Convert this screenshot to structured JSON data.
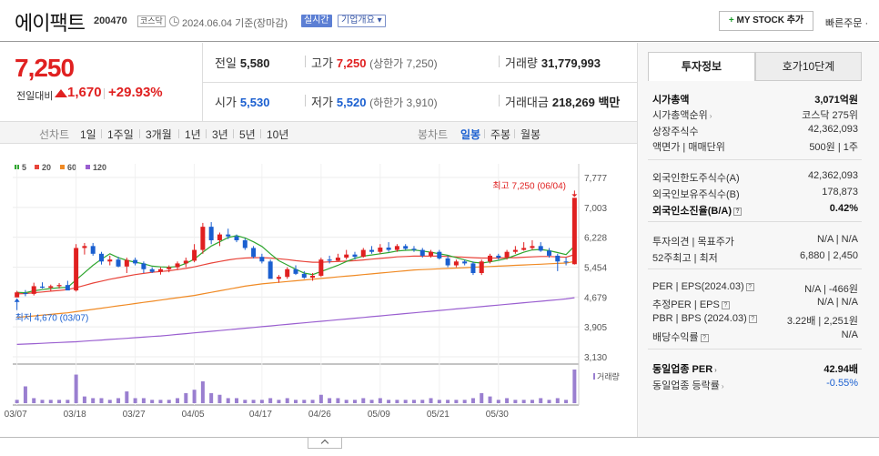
{
  "header": {
    "stock_name": "에이팩트",
    "stock_code": "200470",
    "market": "코스닥",
    "date": "2024.06.04 기준(장마감)",
    "realtime": "실시간",
    "company_info": "기업개요 ▾",
    "my_stock": "MY STOCK 추가",
    "quick_order": "빠른주문 ·"
  },
  "price": {
    "current": "7,250",
    "change_label": "전일대비",
    "change": "1,670",
    "change_rate": "+29.93%"
  },
  "stats": {
    "prev_close_label": "전일",
    "prev_close": "5,580",
    "high_label": "고가",
    "high": "7,250",
    "upper_limit": "(상한가 7,250)",
    "volume_label": "거래량",
    "volume": "31,779,993",
    "open_label": "시가",
    "open": "5,530",
    "low_label": "저가",
    "low": "5,520",
    "lower_limit": "(하한가 3,910)",
    "amount_label": "거래대금",
    "amount": "218,269",
    "amount_unit": "백만"
  },
  "period_bar": {
    "line_chart": "선차트",
    "periods": [
      "1일",
      "1주일",
      "3개월",
      "1년",
      "3년",
      "5년",
      "10년"
    ],
    "candle_chart": "봉차트",
    "candle_periods": [
      "일봉",
      "주봉",
      "월봉"
    ],
    "active_candle": "일봉"
  },
  "chart_data": {
    "type": "candlestick",
    "legend": [
      {
        "name": "5",
        "color": "#2fa62f"
      },
      {
        "name": "20",
        "color": "#e8443a"
      },
      {
        "name": "60",
        "color": "#f08a24"
      },
      {
        "name": "120",
        "color": "#9a5fd0"
      }
    ],
    "y_ticks": [
      "7,777",
      "7,003",
      "6,228",
      "5,454",
      "4,679",
      "3,905",
      "3,130"
    ],
    "ylim": [
      3130,
      7777
    ],
    "x_ticks": [
      "03/07",
      "03/18",
      "03/27",
      "04/05",
      "04/17",
      "04/26",
      "05/09",
      "05/21",
      "05/30"
    ],
    "high_annotation": "최고 7,250 (06/04)",
    "low_annotation": "최저 4,670 (03/07)",
    "volume_label": "거래량",
    "candles": [
      {
        "o": 4670,
        "h": 4840,
        "l": 4670,
        "c": 4800,
        "v": 2
      },
      {
        "o": 4780,
        "h": 4860,
        "l": 4700,
        "c": 4760,
        "v": 10
      },
      {
        "o": 4760,
        "h": 5050,
        "l": 4720,
        "c": 4960,
        "v": 3
      },
      {
        "o": 4950,
        "h": 5060,
        "l": 4900,
        "c": 4920,
        "v": 2
      },
      {
        "o": 4920,
        "h": 5000,
        "l": 4830,
        "c": 4960,
        "v": 2
      },
      {
        "o": 4960,
        "h": 5040,
        "l": 4900,
        "c": 4990,
        "v": 2
      },
      {
        "o": 4990,
        "h": 5100,
        "l": 4860,
        "c": 4850,
        "v": 2
      },
      {
        "o": 4850,
        "h": 6050,
        "l": 4820,
        "c": 5950,
        "v": 17
      },
      {
        "o": 5950,
        "h": 6080,
        "l": 5780,
        "c": 6000,
        "v": 4
      },
      {
        "o": 6000,
        "h": 6080,
        "l": 5750,
        "c": 5800,
        "v": 3
      },
      {
        "o": 5800,
        "h": 5850,
        "l": 5520,
        "c": 5600,
        "v": 3
      },
      {
        "o": 5600,
        "h": 5750,
        "l": 5500,
        "c": 5650,
        "v": 2
      },
      {
        "o": 5650,
        "h": 5720,
        "l": 5450,
        "c": 5470,
        "v": 3
      },
      {
        "o": 5470,
        "h": 5700,
        "l": 5300,
        "c": 5640,
        "v": 7
      },
      {
        "o": 5640,
        "h": 5700,
        "l": 5500,
        "c": 5550,
        "v": 3
      },
      {
        "o": 5550,
        "h": 5600,
        "l": 5300,
        "c": 5400,
        "v": 3
      },
      {
        "o": 5400,
        "h": 5450,
        "l": 5300,
        "c": 5330,
        "v": 2
      },
      {
        "o": 5330,
        "h": 5450,
        "l": 5260,
        "c": 5400,
        "v": 2
      },
      {
        "o": 5400,
        "h": 5500,
        "l": 5320,
        "c": 5450,
        "v": 2
      },
      {
        "o": 5450,
        "h": 5600,
        "l": 5380,
        "c": 5550,
        "v": 3
      },
      {
        "o": 5550,
        "h": 5700,
        "l": 5450,
        "c": 5620,
        "v": 6
      },
      {
        "o": 5620,
        "h": 6050,
        "l": 5580,
        "c": 5900,
        "v": 8
      },
      {
        "o": 5900,
        "h": 6600,
        "l": 5800,
        "c": 6500,
        "v": 13
      },
      {
        "o": 6500,
        "h": 6620,
        "l": 6050,
        "c": 6150,
        "v": 6
      },
      {
        "o": 6150,
        "h": 6350,
        "l": 6000,
        "c": 6300,
        "v": 5
      },
      {
        "o": 6300,
        "h": 6450,
        "l": 6180,
        "c": 6250,
        "v": 3
      },
      {
        "o": 6250,
        "h": 6300,
        "l": 6100,
        "c": 6150,
        "v": 3
      },
      {
        "o": 6150,
        "h": 6200,
        "l": 5900,
        "c": 5950,
        "v": 2
      },
      {
        "o": 5950,
        "h": 6000,
        "l": 5680,
        "c": 5720,
        "v": 2
      },
      {
        "o": 5720,
        "h": 5800,
        "l": 5550,
        "c": 5600,
        "v": 2
      },
      {
        "o": 5600,
        "h": 5650,
        "l": 5400,
        "c": 5150,
        "v": 3
      },
      {
        "o": 5150,
        "h": 5250,
        "l": 5050,
        "c": 5200,
        "v": 2
      },
      {
        "o": 5200,
        "h": 5450,
        "l": 5150,
        "c": 5400,
        "v": 3
      },
      {
        "o": 5400,
        "h": 5500,
        "l": 5250,
        "c": 5280,
        "v": 2
      },
      {
        "o": 5280,
        "h": 5350,
        "l": 5150,
        "c": 5180,
        "v": 2
      },
      {
        "o": 5180,
        "h": 5300,
        "l": 5100,
        "c": 5230,
        "v": 2
      },
      {
        "o": 5230,
        "h": 5700,
        "l": 5200,
        "c": 5650,
        "v": 5
      },
      {
        "o": 5650,
        "h": 5750,
        "l": 5550,
        "c": 5620,
        "v": 3
      },
      {
        "o": 5620,
        "h": 5800,
        "l": 5600,
        "c": 5700,
        "v": 3
      },
      {
        "o": 5700,
        "h": 5900,
        "l": 5650,
        "c": 5780,
        "v": 2
      },
      {
        "o": 5780,
        "h": 5850,
        "l": 5650,
        "c": 5720,
        "v": 2
      },
      {
        "o": 5720,
        "h": 5950,
        "l": 5700,
        "c": 5900,
        "v": 3
      },
      {
        "o": 5900,
        "h": 6000,
        "l": 5800,
        "c": 5850,
        "v": 2
      },
      {
        "o": 5850,
        "h": 6050,
        "l": 5800,
        "c": 5960,
        "v": 3
      },
      {
        "o": 5960,
        "h": 6100,
        "l": 5850,
        "c": 5900,
        "v": 2
      },
      {
        "o": 5900,
        "h": 6050,
        "l": 5850,
        "c": 6000,
        "v": 2
      },
      {
        "o": 6000,
        "h": 6050,
        "l": 5900,
        "c": 5930,
        "v": 2
      },
      {
        "o": 5930,
        "h": 6000,
        "l": 5850,
        "c": 5900,
        "v": 2
      },
      {
        "o": 5900,
        "h": 5950,
        "l": 5700,
        "c": 5750,
        "v": 2
      },
      {
        "o": 5750,
        "h": 5900,
        "l": 5700,
        "c": 5850,
        "v": 3
      },
      {
        "o": 5850,
        "h": 5900,
        "l": 5650,
        "c": 5680,
        "v": 2
      },
      {
        "o": 5680,
        "h": 5750,
        "l": 5450,
        "c": 5500,
        "v": 2
      },
      {
        "o": 5500,
        "h": 5650,
        "l": 5450,
        "c": 5600,
        "v": 2
      },
      {
        "o": 5600,
        "h": 5650,
        "l": 5500,
        "c": 5550,
        "v": 2
      },
      {
        "o": 5550,
        "h": 5600,
        "l": 5250,
        "c": 5300,
        "v": 3
      },
      {
        "o": 5300,
        "h": 5650,
        "l": 5250,
        "c": 5600,
        "v": 6
      },
      {
        "o": 5600,
        "h": 5800,
        "l": 5550,
        "c": 5750,
        "v": 4
      },
      {
        "o": 5750,
        "h": 5800,
        "l": 5650,
        "c": 5700,
        "v": 2
      },
      {
        "o": 5700,
        "h": 5900,
        "l": 5650,
        "c": 5850,
        "v": 3
      },
      {
        "o": 5850,
        "h": 6000,
        "l": 5800,
        "c": 5900,
        "v": 2
      },
      {
        "o": 5900,
        "h": 6100,
        "l": 5880,
        "c": 5950,
        "v": 2
      },
      {
        "o": 5950,
        "h": 6150,
        "l": 5900,
        "c": 6000,
        "v": 2
      },
      {
        "o": 6000,
        "h": 6100,
        "l": 5850,
        "c": 5880,
        "v": 3
      },
      {
        "o": 5880,
        "h": 5950,
        "l": 5700,
        "c": 5750,
        "v": 2
      },
      {
        "o": 5750,
        "h": 5800,
        "l": 5350,
        "c": 5600,
        "v": 3
      },
      {
        "o": 5600,
        "h": 5700,
        "l": 5500,
        "c": 5580,
        "v": 2
      },
      {
        "o": 5530,
        "h": 7250,
        "l": 5520,
        "c": 7250,
        "v": 20
      }
    ],
    "ma5": [
      4800,
      4790,
      4840,
      4870,
      4900,
      4920,
      4930,
      5120,
      5310,
      5500,
      5660,
      5800,
      5700,
      5630,
      5580,
      5540,
      5480,
      5460,
      5450,
      5470,
      5550,
      5660,
      5840,
      6000,
      6110,
      6220,
      6270,
      6210,
      6110,
      5990,
      5800,
      5620,
      5510,
      5400,
      5300,
      5260,
      5340,
      5420,
      5500,
      5600,
      5680,
      5740,
      5770,
      5800,
      5830,
      5870,
      5890,
      5900,
      5870,
      5840,
      5800,
      5760,
      5700,
      5640,
      5580,
      5560,
      5590,
      5630,
      5680,
      5760,
      5840,
      5900,
      5910,
      5880,
      5830,
      5780,
      6000
    ],
    "ma20": [
      4760,
      4770,
      4790,
      4810,
      4830,
      4850,
      4870,
      4920,
      4980,
      5040,
      5090,
      5140,
      5180,
      5220,
      5260,
      5290,
      5320,
      5340,
      5360,
      5390,
      5420,
      5460,
      5510,
      5560,
      5600,
      5640,
      5670,
      5690,
      5700,
      5700,
      5690,
      5670,
      5650,
      5620,
      5600,
      5580,
      5580,
      5590,
      5600,
      5610,
      5620,
      5640,
      5660,
      5680,
      5700,
      5720,
      5730,
      5740,
      5740,
      5740,
      5740,
      5730,
      5720,
      5710,
      5700,
      5690,
      5690,
      5690,
      5700,
      5700,
      5710,
      5720,
      5730,
      5730,
      5720,
      5710,
      5780
    ],
    "ma60": [
      4150,
      4170,
      4190,
      4210,
      4230,
      4250,
      4270,
      4300,
      4330,
      4360,
      4390,
      4420,
      4450,
      4480,
      4510,
      4540,
      4570,
      4600,
      4630,
      4660,
      4690,
      4720,
      4760,
      4800,
      4840,
      4880,
      4920,
      4960,
      4990,
      5020,
      5040,
      5060,
      5080,
      5100,
      5120,
      5140,
      5160,
      5180,
      5200,
      5220,
      5240,
      5260,
      5280,
      5300,
      5320,
      5340,
      5360,
      5380,
      5390,
      5400,
      5410,
      5420,
      5430,
      5440,
      5450,
      5460,
      5470,
      5480,
      5490,
      5500,
      5510,
      5520,
      5530,
      5540,
      5550,
      5560,
      5600
    ],
    "ma120": [
      3450,
      3460,
      3470,
      3480,
      3490,
      3500,
      3510,
      3520,
      3535,
      3550,
      3565,
      3580,
      3595,
      3610,
      3625,
      3640,
      3655,
      3670,
      3690,
      3710,
      3730,
      3750,
      3770,
      3790,
      3810,
      3830,
      3850,
      3870,
      3890,
      3910,
      3930,
      3950,
      3970,
      3990,
      4010,
      4030,
      4050,
      4070,
      4090,
      4110,
      4130,
      4150,
      4170,
      4190,
      4210,
      4230,
      4250,
      4270,
      4290,
      4310,
      4330,
      4350,
      4370,
      4390,
      4410,
      4430,
      4450,
      4470,
      4490,
      4510,
      4530,
      4550,
      4570,
      4590,
      4610,
      4630,
      4660
    ]
  },
  "info_panel": {
    "tab_invest": "투자정보",
    "tab_orderbook": "호가10단계",
    "rows": [
      {
        "k": "시가총액",
        "v": "3,071억원",
        "bold": true
      },
      {
        "k": "시가총액순위",
        "v": "코스닥 275위",
        "arrow": true
      },
      {
        "k": "상장주식수",
        "v": "42,362,093"
      },
      {
        "k": "액면가 | 매매단위",
        "v": "500원 | 1주"
      },
      {
        "k": "외국인한도주식수(A)",
        "v": "42,362,093"
      },
      {
        "k": "외국인보유주식수(B)",
        "v": "178,873"
      },
      {
        "k": "외국인소진율(B/A)",
        "v": "0.42%",
        "bold": true,
        "help": true
      },
      {
        "k": "투자의견 | 목표주가",
        "v": "N/A | N/A"
      },
      {
        "k": "52주최고 | 최저",
        "v": "6,880 | 2,450"
      },
      {
        "k": "PER | EPS(2024.03)",
        "v": "N/A | -466원",
        "help": true
      },
      {
        "k": "추정PER | EPS",
        "v": "N/A | N/A",
        "help": true
      },
      {
        "k": "PBR | BPS (2024.03)",
        "v": "3.22배 | 2,251원",
        "help": true
      },
      {
        "k": "배당수익률",
        "v": "N/A",
        "help": true
      },
      {
        "k": "동일업종 PER",
        "v": "42.94배",
        "bold": true,
        "arrow": true
      },
      {
        "k": "동일업종 등락률",
        "v": "-0.55%",
        "arrow": true,
        "blue": true
      }
    ]
  }
}
